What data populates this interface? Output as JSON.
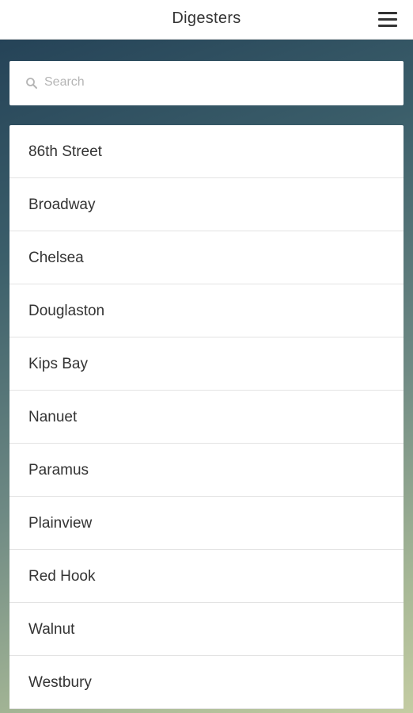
{
  "header": {
    "title": "Digesters",
    "menu_icon": "hamburger-menu-icon"
  },
  "search": {
    "placeholder": "Search",
    "value": "",
    "icon": "search-icon"
  },
  "locations": [
    "86th Street",
    "Broadway",
    "Chelsea",
    "Douglaston",
    "Kips Bay",
    "Nanuet",
    "Paramus",
    "Plainview",
    "Red Hook",
    "Walnut",
    "Westbury"
  ],
  "colors": {
    "header_bg": "#ffffff",
    "text": "#333333",
    "placeholder": "#b5b5b5",
    "gradient_top": "#213e54",
    "gradient_bottom": "#c4cca2"
  }
}
